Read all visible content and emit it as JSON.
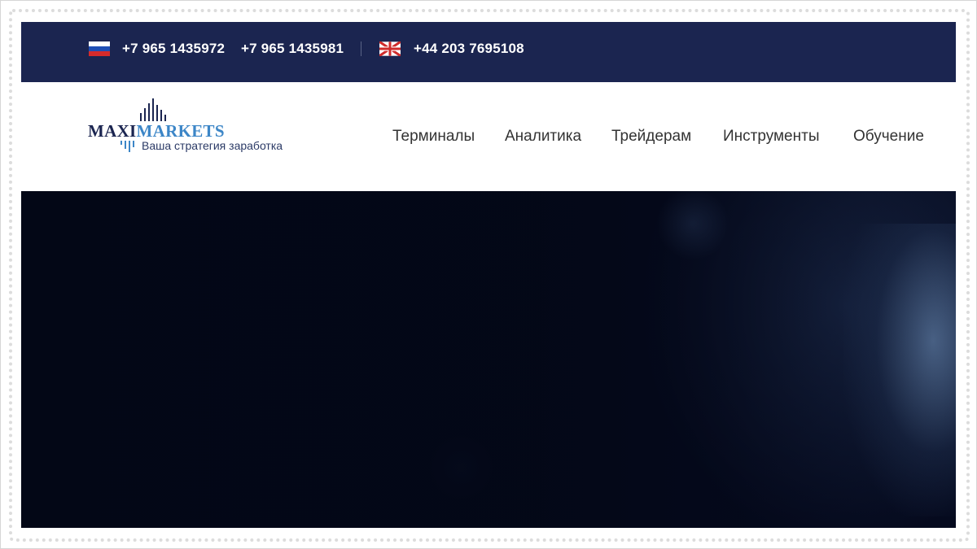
{
  "topbar": {
    "phones": [
      "+7 965 1435972",
      "+7 965 1435981",
      "+44 203 7695108"
    ],
    "flags": [
      "russia-flag-icon",
      "uk-flag-icon"
    ],
    "background_color": "#1b2550"
  },
  "logo": {
    "word_maxi": "MAXI",
    "word_markets": "MARKETS",
    "tagline": "Ваша стратегия заработка",
    "colors": {
      "maxi": "#1b2550",
      "markets": "#3c86c7"
    }
  },
  "nav": {
    "items": [
      {
        "label": "Терминалы"
      },
      {
        "label": "Аналитика"
      },
      {
        "label": "Трейдерам"
      },
      {
        "label": "Инструменты"
      },
      {
        "label": "Обучение"
      }
    ]
  },
  "hero": {
    "background_color": "#050a1e"
  }
}
